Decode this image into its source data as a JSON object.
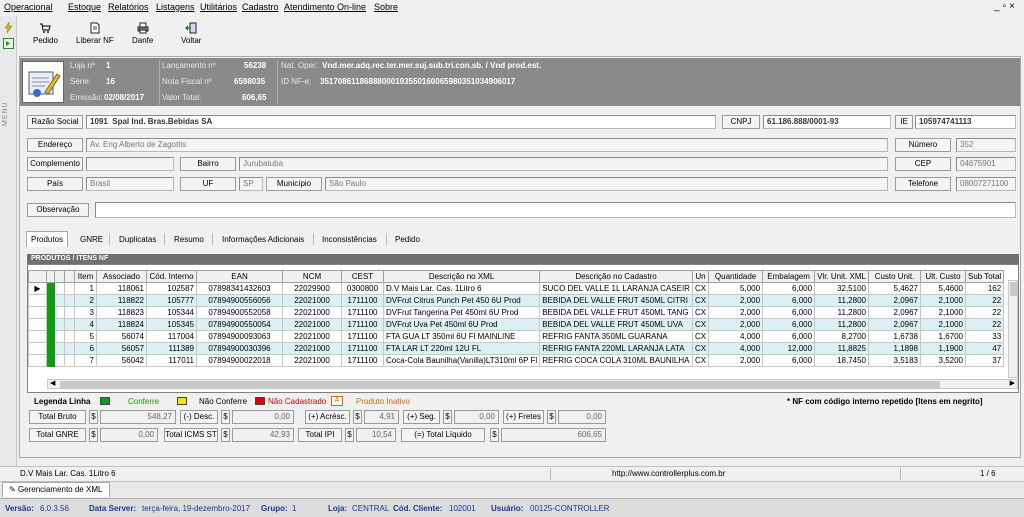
{
  "menu": [
    "Operacional",
    "Estoque",
    "Relatórios",
    "Listagens",
    "Utilitários",
    "Cadastro",
    "Atendimento On-line",
    "Sobre"
  ],
  "window_controls": "_ & x",
  "toolbar": {
    "pedido": "Pedido",
    "liberar_nf": "Liberar NF",
    "danfe": "Danfe",
    "voltar": "Voltar"
  },
  "sidebar_vertical_label": "MENU",
  "header": {
    "loja_label": "Loja nº",
    "loja_value": "1",
    "serie_label": "Série:",
    "serie_value": "16",
    "emissao_label": "Emissão:",
    "emissao_value": "02/08/2017",
    "lancamento_label": "Lançamento nº",
    "lancamento_value": "56238",
    "nota_label": "Nota Fiscal nº",
    "nota_value": "6598035",
    "valor_label": "Valor Total:",
    "valor_value": "606,65",
    "natoper_label": "Nat. Oper:",
    "natoper_value": "Vnd.mer.adq.rec.ter.mer.suj.sub.tri.con.sb. / Vnd prod.est.",
    "idnfe_label": "ID NF-e:",
    "idnfe_value": "35170861186888000193550160065980351034906017"
  },
  "form": {
    "razao_label": "Razão Social",
    "razao_code": "1091",
    "razao_value": "Spal Ind. Bras.Bebidas SA",
    "cnpj_label": "CNPJ",
    "cnpj_value": "61.186.888/0001-93",
    "ie_label": "IE",
    "ie_value": "105974741113",
    "endereco_label": "Endereço",
    "endereco_value": "Av. Eng Alberto de Zagottis",
    "numero_label": "Número",
    "numero_value": "352",
    "complemento_label": "Complemento",
    "complemento_value": "",
    "bairro_label": "Bairro",
    "bairro_value": "Jurubatuba",
    "cep_label": "CEP",
    "cep_value": "04675901",
    "pais_label": "País",
    "pais_value": "Brasil",
    "uf_label": "UF",
    "uf_value": "SP",
    "municipio_label": "Município",
    "municipio_value": "São Paulo",
    "telefone_label": "Telefone",
    "telefone_value": "08007271100",
    "observacao_label": "Observação",
    "observacao_value": ""
  },
  "tabs": [
    "Produtos",
    "GNRE",
    "Duplicatas",
    "Resumo",
    "Informações Adicionais",
    "Inconsistências",
    "Pedido"
  ],
  "grid": {
    "title": "PRODUTOS / ITENS NF",
    "columns": [
      "Item",
      "Associado",
      "Cód. Interno",
      "EAN",
      "NCM",
      "CEST",
      "Descrição no XML",
      "Descrição no Cadastro",
      "Un",
      "Quantidade",
      "Embalagem",
      "Vlr. Unit. XML",
      "Custo Unit.",
      "Ult. Custo",
      "Sub Total"
    ],
    "rows": [
      [
        "1",
        "118061",
        "102587",
        "07898341432603",
        "22029900",
        "0300800",
        "D.V Mais Lar. Cas. 1Litro 6",
        "SUCO DEL VALLE 1L LARANJA CASEIR",
        "CX",
        "5,000",
        "6,000",
        "32,5100",
        "5,4627",
        "5,4600",
        "162"
      ],
      [
        "2",
        "118822",
        "105777",
        "07894900556056",
        "22021000",
        "1711100",
        "DVFrut Citrus Punch Pet 450 6U Prod",
        "BEBIDA DEL VALLE FRUT 450ML CITRI",
        "CX",
        "2,000",
        "6,000",
        "11,2800",
        "2,0967",
        "2,1000",
        "22"
      ],
      [
        "3",
        "118823",
        "105344",
        "07894900552058",
        "22021000",
        "1711100",
        "DVFrut Tangerina Pet 450ml 6U Prod",
        "BEBIDA DEL VALLE FRUT 450ML TANG",
        "CX",
        "2,000",
        "6,000",
        "11,2800",
        "2,0967",
        "2,1000",
        "22"
      ],
      [
        "4",
        "118824",
        "105345",
        "07894900550054",
        "22021000",
        "1711100",
        "DVFrut Uva Pet 450ml 6U Prod",
        "BEBIDA DEL VALLE FRUT 450ML UVA",
        "CX",
        "2,000",
        "6,000",
        "11,2800",
        "2,0967",
        "2,1000",
        "22"
      ],
      [
        "5",
        "56074",
        "117004",
        "07894900093063",
        "22021000",
        "1711100",
        "FTA GUA LT 350ml 6U Fl MAINLINE",
        "REFRIG FANTA 350ML GUARANA",
        "CX",
        "4,000",
        "6,000",
        "8,2700",
        "1,6738",
        "1,6700",
        "33"
      ],
      [
        "6",
        "56057",
        "111389",
        "07894900030396",
        "22021000",
        "1711100",
        "FTA LAR LT 220ml 12U FL",
        "REFRIG FANTA 220ML LARANJA LATA",
        "CX",
        "4,000",
        "12,000",
        "11,8825",
        "1,1898",
        "1,1900",
        "47"
      ],
      [
        "7",
        "56042",
        "117011",
        "07894900022018",
        "22021000",
        "1711100",
        "Coca-Cola Baunilha(Vanilla)LT310ml 6P Fl",
        "REFRIG COCA COLA 310ML BAUNILHA",
        "CX",
        "2,000",
        "6,000",
        "18,7450",
        "3,5183",
        "3,5200",
        "37"
      ]
    ]
  },
  "legend": {
    "title": "Legenda Linha",
    "confere": "Conferre",
    "nao_confere": "Não Conferre",
    "nao_cadastrado": "Não Cadastrado",
    "inativo_marker": "A",
    "inativo": "Produto Inativo",
    "note": "* NF com código interno repetido [Itens em negrito]",
    "colors": {
      "confere": "#0f9a0f",
      "nao_confere": "#f5e400",
      "nao_cadastrado": "#e00000",
      "inativo": "#d07000"
    }
  },
  "totals": {
    "total_bruto_label": "Total Bruto",
    "total_bruto_value": "548,27",
    "desc_label": "(-) Desc.",
    "desc_value": "0,00",
    "acresc_label": "(+) Acrésc.",
    "acresc_value": "4,91",
    "seg_label": "(+) Seg.",
    "seg_value": "0,00",
    "fretes_label": "(+) Fretes",
    "fretes_value": "0,00",
    "gnre_label": "Total GNRE",
    "gnre_value": "0,00",
    "icms_st_label": "Total ICMS ST",
    "icms_st_value": "42,93",
    "ipi_label": "Total IPI",
    "ipi_value": "10,54",
    "liquido_label": "(=) Total Líquido",
    "liquido_value": "606,65",
    "currency": "$"
  },
  "status": {
    "left": "D.V Mais Lar. Cas. 1Litro 6",
    "url": "http://www.controllerplus.com.br",
    "page": "1 / 6"
  },
  "doc_tab": "Gerenciamento de XML",
  "version_bar": {
    "versao_label": "Versão:",
    "versao_value": "6.0.3.56",
    "data_label": "Data Server:",
    "data_value": "terça-feira, 19-dezembro-2017",
    "grupo_label": "Grupo:",
    "grupo_value": "1",
    "loja_label": "Loja:",
    "loja_value": "CENTRAL",
    "cliente_label": "Cód. Cliente:",
    "cliente_value": "102001",
    "usuario_label": "Usuário:",
    "usuario_value": "00125-CONTROLLER"
  }
}
